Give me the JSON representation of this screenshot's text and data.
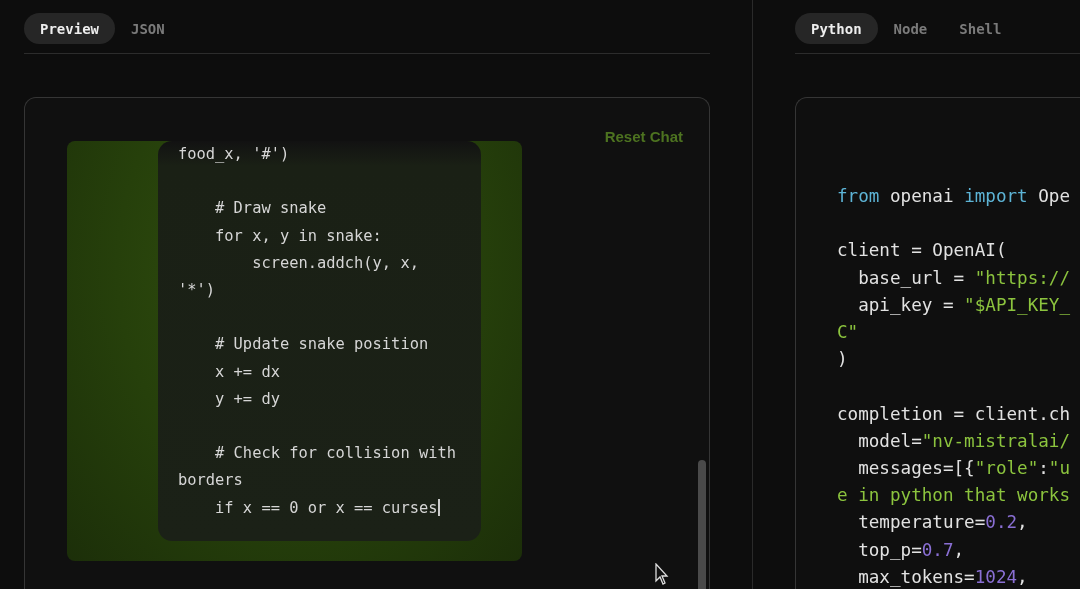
{
  "preview_tabs": [
    {
      "label": "Preview",
      "selected": true
    },
    {
      "label": "JSON",
      "selected": false
    }
  ],
  "preview": {
    "reset_button": "Reset Chat",
    "code_blocks": [
      [
        "food_x, '#')"
      ],
      [
        "    # Draw snake",
        "    for x, y in snake:",
        "        screen.addch(y, x,",
        "'*')"
      ],
      [
        "    # Update snake position",
        "    x += dx",
        "    y += dy"
      ],
      [
        "    # Check for collision with",
        "borders",
        "    if x == 0 or x == curses"
      ]
    ]
  },
  "code_tabs": [
    {
      "label": "Python",
      "selected": true
    },
    {
      "label": "Node",
      "selected": false
    },
    {
      "label": "Shell",
      "selected": false
    }
  ],
  "code_sample": {
    "blocks": [
      [
        [
          {
            "text": "from",
            "kind": "keyword"
          },
          {
            "text": " openai ",
            "kind": "plain"
          },
          {
            "text": "import",
            "kind": "keyword"
          },
          {
            "text": " Ope",
            "kind": "plain"
          }
        ]
      ],
      [
        [
          {
            "text": "client = OpenAI(",
            "kind": "plain"
          }
        ],
        [
          {
            "text": "  base_url = ",
            "kind": "plain"
          },
          {
            "text": "\"https://",
            "kind": "string"
          }
        ],
        [
          {
            "text": "  api_key = ",
            "kind": "plain"
          },
          {
            "text": "\"$API_KEY_",
            "kind": "string"
          }
        ],
        [
          {
            "text": "C\"",
            "kind": "string"
          }
        ],
        [
          {
            "text": ")",
            "kind": "plain"
          }
        ]
      ],
      [
        [
          {
            "text": "completion = client.ch",
            "kind": "plain"
          }
        ],
        [
          {
            "text": "  model=",
            "kind": "plain"
          },
          {
            "text": "\"nv-mistralai/",
            "kind": "string"
          }
        ],
        [
          {
            "text": "  messages=[{",
            "kind": "plain"
          },
          {
            "text": "\"role\"",
            "kind": "string"
          },
          {
            "text": ":",
            "kind": "plain"
          },
          {
            "text": "\"u",
            "kind": "string"
          }
        ],
        [
          {
            "text": "e in python that works",
            "kind": "string"
          }
        ],
        [
          {
            "text": "  temperature=",
            "kind": "plain"
          },
          {
            "text": "0.2",
            "kind": "number"
          },
          {
            "text": ",",
            "kind": "plain"
          }
        ],
        [
          {
            "text": "  top_p=",
            "kind": "plain"
          },
          {
            "text": "0.7",
            "kind": "number"
          },
          {
            "text": ",",
            "kind": "plain"
          }
        ],
        [
          {
            "text": "  max_tokens=",
            "kind": "plain"
          },
          {
            "text": "1024",
            "kind": "number"
          },
          {
            "text": ",",
            "kind": "plain"
          }
        ]
      ]
    ]
  }
}
